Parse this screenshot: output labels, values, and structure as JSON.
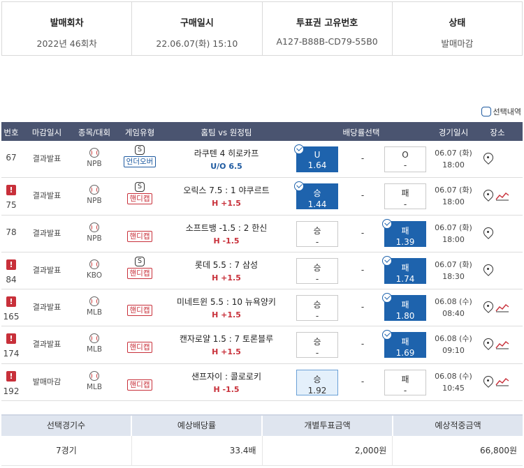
{
  "info": [
    {
      "label": "발매회차",
      "value": "2022년 46회차"
    },
    {
      "label": "구매일시",
      "value": "22.06.07(화) 15:10"
    },
    {
      "label": "투표권 고유번호",
      "value": "A127-B88B-CD79-55B0"
    },
    {
      "label": "상태",
      "value": "발매마감"
    }
  ],
  "select_history_label": "선택내역",
  "table": {
    "headers": [
      "번호",
      "마감일시",
      "종목/대회",
      "게임유형",
      "홈팀 vs 원정팀",
      "배당률선택",
      "경기일시",
      "장소"
    ],
    "rows": [
      {
        "no": "67",
        "warn": false,
        "deadline": "결과발표",
        "league": "NPB",
        "s_icon": "S",
        "type_tag": "언더오버",
        "type_kind": "uo",
        "teams": "라쿠텐   4   히로카프",
        "sub": "U/O 6.5",
        "home_l1": "U",
        "home_l2": "1.64",
        "home_state": "sel",
        "draw": "-",
        "away_l1": "O",
        "away_l2": "-",
        "away_state": "",
        "date": "06.07 (화)",
        "time": "18:00",
        "trend": false
      },
      {
        "no": "75",
        "warn": true,
        "deadline": "결과발표",
        "league": "NPB",
        "s_icon": "S",
        "type_tag": "핸디캡",
        "type_kind": "hd",
        "teams": "오릭스 7.5 : 1 야쿠르트",
        "sub": "H +1.5",
        "home_l1": "승",
        "home_l2": "1.44",
        "home_state": "sel",
        "draw": "-",
        "away_l1": "패",
        "away_l2": "-",
        "away_state": "",
        "date": "06.07 (화)",
        "time": "18:00",
        "trend": true
      },
      {
        "no": "78",
        "warn": false,
        "deadline": "결과발표",
        "league": "NPB",
        "s_icon": "",
        "type_tag": "핸디캡",
        "type_kind": "hd",
        "teams": "소프트뱅 -1.5 : 2 한신",
        "sub": "H -1.5",
        "home_l1": "승",
        "home_l2": "-",
        "home_state": "",
        "draw": "-",
        "away_l1": "패",
        "away_l2": "1.39",
        "away_state": "sel",
        "date": "06.07 (화)",
        "time": "18:00",
        "trend": false
      },
      {
        "no": "84",
        "warn": true,
        "deadline": "결과발표",
        "league": "KBO",
        "s_icon": "S",
        "type_tag": "핸디캡",
        "type_kind": "hd",
        "teams": "롯데 5.5 : 7 삼성",
        "sub": "H +1.5",
        "home_l1": "승",
        "home_l2": "-",
        "home_state": "",
        "draw": "-",
        "away_l1": "패",
        "away_l2": "1.74",
        "away_state": "sel",
        "date": "06.07 (화)",
        "time": "18:30",
        "trend": false
      },
      {
        "no": "165",
        "warn": true,
        "deadline": "결과발표",
        "league": "MLB",
        "s_icon": "",
        "type_tag": "핸디캡",
        "type_kind": "hd",
        "teams": "미네트윈 5.5 : 10 뉴욕양키",
        "sub": "H +1.5",
        "home_l1": "승",
        "home_l2": "-",
        "home_state": "",
        "draw": "-",
        "away_l1": "패",
        "away_l2": "1.80",
        "away_state": "sel",
        "date": "06.08 (수)",
        "time": "08:40",
        "trend": true
      },
      {
        "no": "174",
        "warn": true,
        "deadline": "결과발표",
        "league": "MLB",
        "s_icon": "",
        "type_tag": "핸디캡",
        "type_kind": "hd",
        "teams": "캔자로얄 1.5 : 7 토론블루",
        "sub": "H +1.5",
        "home_l1": "승",
        "home_l2": "-",
        "home_state": "",
        "draw": "-",
        "away_l1": "패",
        "away_l2": "1.69",
        "away_state": "sel",
        "date": "06.08 (수)",
        "time": "09:10",
        "trend": true
      },
      {
        "no": "192",
        "warn": true,
        "deadline": "발매마감",
        "league": "MLB",
        "s_icon": "",
        "type_tag": "핸디캡",
        "type_kind": "hd",
        "teams": "샌프자이 : 콜로로키",
        "sub": "H -1.5",
        "home_l1": "승",
        "home_l2": "1.92",
        "home_state": "sel2",
        "draw": "-",
        "away_l1": "패",
        "away_l2": "-",
        "away_state": "",
        "date": "06.08 (수)",
        "time": "10:45",
        "trend": true
      }
    ]
  },
  "summary": {
    "headers": [
      "선택경기수",
      "예상배당률",
      "개별투표금액",
      "예상적중금액"
    ],
    "values": [
      "7경기",
      "33.4배",
      "2,000원",
      "66,800원"
    ]
  },
  "colors": {
    "header_bg": "#4a5470",
    "selected_odd": "#1e63ad",
    "handicap": "#c8303a",
    "under_over": "#1e5aa0"
  }
}
